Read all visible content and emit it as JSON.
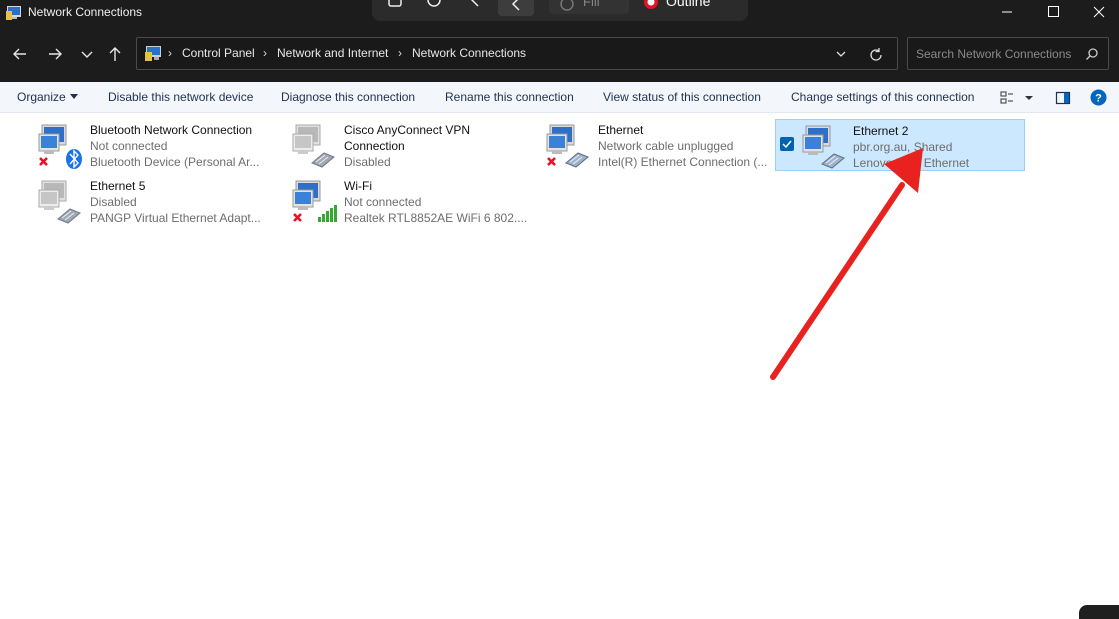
{
  "window": {
    "title": "Network Connections"
  },
  "overlay_toolbar": {
    "fill_label": "Fill",
    "outline_label": "Outline"
  },
  "address_bar": {
    "crumbs": [
      "Control Panel",
      "Network and Internet",
      "Network Connections"
    ]
  },
  "search": {
    "placeholder": "Search Network Connections"
  },
  "commands": {
    "organize": "Organize",
    "disable": "Disable this network device",
    "diagnose": "Diagnose this connection",
    "rename": "Rename this connection",
    "view_status": "View status of this connection",
    "change_settings": "Change settings of this connection"
  },
  "connections": [
    {
      "name": "Bluetooth Network Connection",
      "status": "Not connected",
      "device": "Bluetooth Device (Personal Ar...",
      "badge": "red-x",
      "kind": "bluetooth"
    },
    {
      "name": "Cisco AnyConnect VPN",
      "name2": "Connection",
      "status": "Disabled",
      "device": "",
      "badge": "none",
      "kind": "ethernet-disabled"
    },
    {
      "name": "Ethernet",
      "status": "Network cable unplugged",
      "device": "Intel(R) Ethernet Connection (...",
      "badge": "red-x",
      "kind": "ethernet"
    },
    {
      "name": "Ethernet 2",
      "status": "pbr.org.au, Shared",
      "device": "Lenovo USB Ethernet",
      "badge": "none",
      "kind": "ethernet",
      "selected": true
    },
    {
      "name": "Ethernet 5",
      "status": "Disabled",
      "device": "PANGP Virtual Ethernet Adapt...",
      "badge": "none",
      "kind": "ethernet-disabled"
    },
    {
      "name": "Wi-Fi",
      "status": "Not connected",
      "device": "Realtek RTL8852AE WiFi 6 802....",
      "badge": "red-x",
      "kind": "wifi"
    }
  ],
  "colors": {
    "titlebar": "#1c1c1c",
    "cmdbar": "#f3f6fa",
    "selection": "#cce8ff",
    "selection_border": "#99d1ff",
    "arrow": "#e8231f",
    "red_x": "#e81123"
  }
}
